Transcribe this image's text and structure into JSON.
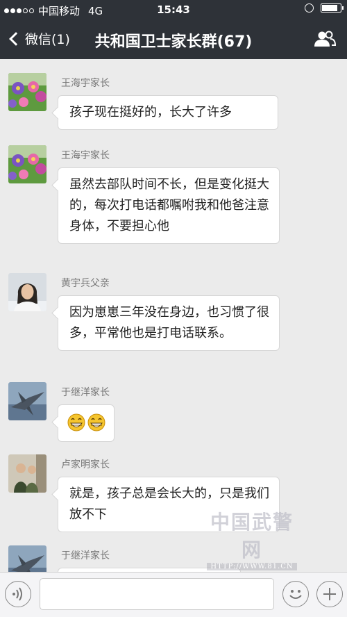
{
  "status_bar": {
    "carrier": "中国移动",
    "network": "4G",
    "time": "15:43",
    "signal_bars_filled": 3,
    "signal_bars_total": 5
  },
  "nav": {
    "back_label": "微信(1)",
    "title": "共和国卫士家长群(67)",
    "members_icon": "people-icon"
  },
  "messages": [
    {
      "sender": "王海宇家长",
      "text": "孩子现在挺好的，长大了许多",
      "avatar": "flowers-photo"
    },
    {
      "sender": "王海宇家长",
      "text": "虽然去部队时间不长，但是变化挺大的，每次打电话都嘱咐我和他爸注意身体，不要担心他",
      "avatar": "flowers-photo"
    },
    {
      "sender": "黄宇兵父亲",
      "text": "因为崽崽三年没在身边，也习惯了很多，平常他也是打电话联系。",
      "avatar": "portrait-photo"
    },
    {
      "sender": "于继洋家长",
      "text": "",
      "emoji": [
        "grinning-emoji",
        "grinning-emoji"
      ],
      "avatar": "jet-photo"
    },
    {
      "sender": "卢家明家长",
      "text": "就是，孩子总是会长大的，只是我们放不下",
      "avatar": "couple-photo"
    },
    {
      "sender": "于继洋家长",
      "text": "",
      "avatar": "jet-photo"
    }
  ],
  "watermark": {
    "line1": "中国武警网",
    "line2": "HTTP://WWW.81.CN"
  },
  "input_bar": {
    "voice_icon": "voice-icon",
    "emoji_icon": "emoji-icon",
    "plus_icon": "plus-icon"
  },
  "colors": {
    "bar_bg": "#2e3238",
    "chat_bg": "#ebebeb",
    "bubble_bg": "#ffffff"
  }
}
